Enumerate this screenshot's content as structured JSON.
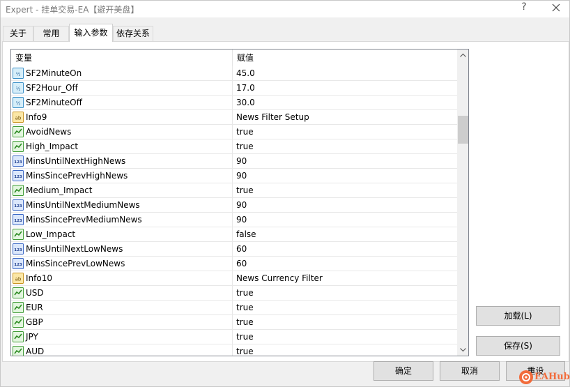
{
  "window": {
    "title": "Expert - 挂单交易-EA【避开美盘】",
    "help_glyph": "?"
  },
  "tabs": [
    {
      "label": "关于",
      "active": false
    },
    {
      "label": "常用",
      "active": false
    },
    {
      "label": "输入参数",
      "active": true
    },
    {
      "label": "依存关系",
      "active": false
    }
  ],
  "grid": {
    "header": {
      "variable": "变量",
      "value": "赋值"
    },
    "rows": [
      {
        "icon": "half-icon",
        "name": "SF2MinuteOn",
        "value": "45.0"
      },
      {
        "icon": "half-icon",
        "name": "SF2Hour_Off",
        "value": "17.0"
      },
      {
        "icon": "half-icon",
        "name": "SF2MinuteOff",
        "value": "30.0"
      },
      {
        "icon": "ab-icon",
        "name": "Info9",
        "value": "News Filter Setup"
      },
      {
        "icon": "bool-icon",
        "name": "AvoidNews",
        "value": "true"
      },
      {
        "icon": "bool-icon",
        "name": "High_Impact",
        "value": "true"
      },
      {
        "icon": "int-icon",
        "name": "MinsUntilNextHighNews",
        "value": "90"
      },
      {
        "icon": "int-icon",
        "name": "MinsSincePrevHighNews",
        "value": "90"
      },
      {
        "icon": "bool-icon",
        "name": "Medium_Impact",
        "value": "true"
      },
      {
        "icon": "int-icon",
        "name": "MinsUntilNextMediumNews",
        "value": "90"
      },
      {
        "icon": "int-icon",
        "name": "MinsSincePrevMediumNews",
        "value": "90"
      },
      {
        "icon": "bool-icon",
        "name": "Low_Impact",
        "value": "false"
      },
      {
        "icon": "int-icon",
        "name": "MinsUntilNextLowNews",
        "value": "60"
      },
      {
        "icon": "int-icon",
        "name": "MinsSincePrevLowNews",
        "value": "60"
      },
      {
        "icon": "ab-icon",
        "name": "Info10",
        "value": "News Currency Filter"
      },
      {
        "icon": "bool-icon",
        "name": "USD",
        "value": "true"
      },
      {
        "icon": "bool-icon",
        "name": "EUR",
        "value": "true"
      },
      {
        "icon": "bool-icon",
        "name": "GBP",
        "value": "true"
      },
      {
        "icon": "bool-icon",
        "name": "JPY",
        "value": "true"
      },
      {
        "icon": "bool-icon",
        "name": "AUD",
        "value": "true"
      }
    ]
  },
  "buttons": {
    "load": "加载(L)",
    "save": "保存(S)",
    "ok": "确定",
    "cancel": "取消",
    "reset": "重设"
  },
  "watermark": {
    "text": "EAHub"
  },
  "colors": {
    "accent": "#f26b3a",
    "grid_border": "#828790"
  }
}
